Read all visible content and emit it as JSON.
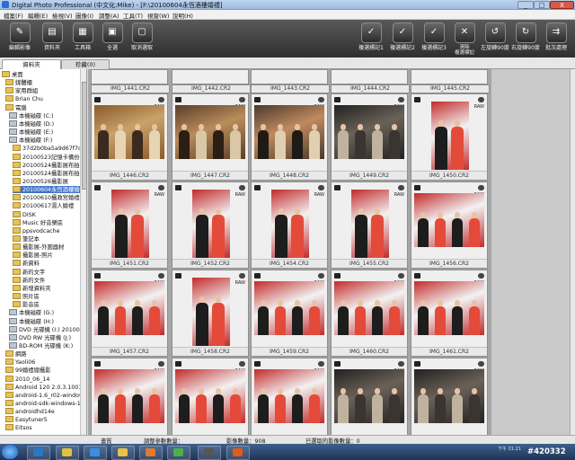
{
  "window": {
    "title": "Digital Photo Professional (中文化:Mike) - [F:\\20100604永恆酒樓婚禮]",
    "min_glyph": "_",
    "max_glyph": "□",
    "close_glyph": "X"
  },
  "menu": [
    "檔案(F)",
    "編輯(E)",
    "檢視(V)",
    "圖像(I)",
    "調整(A)",
    "工具(T)",
    "視窗(W)",
    "說明(H)"
  ],
  "toolbar": {
    "left": [
      {
        "label": "編輯影像",
        "icon": "edit-image-icon",
        "glyph": "✎"
      },
      {
        "label": "資料夾",
        "icon": "folder-icon",
        "glyph": "▤"
      },
      {
        "label": "工具箱",
        "icon": "toolbox-icon",
        "glyph": "▦"
      },
      {
        "label": "全選",
        "icon": "select-all-icon",
        "glyph": "▣"
      },
      {
        "label": "取消選取",
        "icon": "deselect-icon",
        "glyph": "▢"
      }
    ],
    "right": [
      {
        "label": "複選標記1",
        "icon": "check-mark-1-icon",
        "glyph": "✓"
      },
      {
        "label": "複選標記2",
        "icon": "check-mark-2-icon",
        "glyph": "✓"
      },
      {
        "label": "複選標記3",
        "icon": "check-mark-3-icon",
        "glyph": "✓"
      },
      {
        "label": "清除\n複選標記",
        "icon": "clear-check-icon",
        "glyph": "✕"
      },
      {
        "label": "左旋轉90度",
        "icon": "rotate-left-icon",
        "glyph": "↺"
      },
      {
        "label": "右旋轉90度",
        "icon": "rotate-right-icon",
        "glyph": "↻"
      },
      {
        "label": "批次處理",
        "icon": "batch-process-icon",
        "glyph": "⇉"
      }
    ]
  },
  "tabs": [
    "資料夾",
    "珍藏(0)"
  ],
  "tree": [
    {
      "label": "桌面",
      "indent": 0,
      "kind": "folder"
    },
    {
      "label": "媒體櫃",
      "indent": 1,
      "kind": "folder"
    },
    {
      "label": "家用群組",
      "indent": 1,
      "kind": "folder"
    },
    {
      "label": "Brian Chu",
      "indent": 1,
      "kind": "folder"
    },
    {
      "label": "電腦",
      "indent": 1,
      "kind": "folder"
    },
    {
      "label": "本機磁碟 (C:)",
      "indent": 2,
      "kind": "drive"
    },
    {
      "label": "本機磁碟 (D:)",
      "indent": 2,
      "kind": "drive"
    },
    {
      "label": "本機磁碟 (E:)",
      "indent": 2,
      "kind": "drive"
    },
    {
      "label": "本機磁碟 (F:)",
      "indent": 2,
      "kind": "drive"
    },
    {
      "label": "37d2b0ba5a9d67f7c6",
      "indent": 3,
      "kind": "folder"
    },
    {
      "label": "20100523記憶卡備份",
      "indent": 3,
      "kind": "folder"
    },
    {
      "label": "20100524攝影展布拍",
      "indent": 3,
      "kind": "folder"
    },
    {
      "label": "20100524攝影展布拍-F",
      "indent": 3,
      "kind": "folder"
    },
    {
      "label": "20100526攝影展",
      "indent": 3,
      "kind": "folder"
    },
    {
      "label": "20100604永恆酒樓婚禮",
      "indent": 3,
      "kind": "folder",
      "selected": true
    },
    {
      "label": "20100610攝政宮婚禮新",
      "indent": 3,
      "kind": "folder"
    },
    {
      "label": "20100617湯人婚禮",
      "indent": 3,
      "kind": "folder"
    },
    {
      "label": "DISK",
      "indent": 3,
      "kind": "folder"
    },
    {
      "label": "Music 好音樂區",
      "indent": 3,
      "kind": "folder"
    },
    {
      "label": "ppsvodcache",
      "indent": 3,
      "kind": "folder"
    },
    {
      "label": "筆記本",
      "indent": 3,
      "kind": "folder"
    },
    {
      "label": "攝影展-外圍器材",
      "indent": 3,
      "kind": "folder"
    },
    {
      "label": "攝影展-照片",
      "indent": 3,
      "kind": "folder"
    },
    {
      "label": "新資料",
      "indent": 3,
      "kind": "folder"
    },
    {
      "label": "新的文字",
      "indent": 3,
      "kind": "folder"
    },
    {
      "label": "新的文件",
      "indent": 3,
      "kind": "folder"
    },
    {
      "label": "新增資料夾",
      "indent": 3,
      "kind": "folder"
    },
    {
      "label": "照片區",
      "indent": 3,
      "kind": "folder"
    },
    {
      "label": "影音區",
      "indent": 3,
      "kind": "folder"
    },
    {
      "label": "本機磁碟 (G:)",
      "indent": 2,
      "kind": "drive"
    },
    {
      "label": "本機磁碟 (H:)",
      "indent": 2,
      "kind": "drive"
    },
    {
      "label": "DVD 光碟機 (I:) 20100727",
      "indent": 2,
      "kind": "drive"
    },
    {
      "label": "DVD RW 光碟機 (J:)",
      "indent": 2,
      "kind": "drive"
    },
    {
      "label": "BD-ROM 光碟機 (K:)",
      "indent": 2,
      "kind": "drive"
    },
    {
      "label": "網路",
      "indent": 1,
      "kind": "folder"
    },
    {
      "label": "Yaoli06",
      "indent": 1,
      "kind": "folder"
    },
    {
      "label": "99婚禮總攝影",
      "indent": 1,
      "kind": "folder"
    },
    {
      "label": "2010_06_14",
      "indent": 1,
      "kind": "folder"
    },
    {
      "label": "Android 120 2.0.3.1001",
      "indent": 1,
      "kind": "folder"
    },
    {
      "label": "android-1.6_r02-windows",
      "indent": 1,
      "kind": "folder"
    },
    {
      "label": "android-sdk-windows-1.5_r1",
      "indent": 1,
      "kind": "folder"
    },
    {
      "label": "androidhd14e",
      "indent": 1,
      "kind": "folder"
    },
    {
      "label": "Easytuner5",
      "indent": 1,
      "kind": "folder"
    },
    {
      "label": "Eitsos",
      "indent": 1,
      "kind": "folder"
    }
  ],
  "thumbnails": {
    "top_names": [
      "IMG_1441.CR2",
      "IMG_1442.CR2",
      "IMG_1443.CR2",
      "IMG_1444.CR2",
      "IMG_1445.CR2"
    ],
    "rows": [
      [
        "IMG_1446.CR2",
        "IMG_1447.CR2",
        "IMG_1448.CR2",
        "IMG_1449.CR2",
        "IMG_1450.CR2"
      ],
      [
        "IMG_1451.CR2",
        "IMG_1452.CR2",
        "IMG_1454.CR2",
        "IMG_1455.CR2",
        "IMG_1456.CR2"
      ],
      [
        "IMG_1457.CR2",
        "IMG_1458.CR2",
        "IMG_1459.CR2",
        "IMG_1460.CR2",
        "IMG_1461.CR2"
      ],
      [
        "",
        "",
        "",
        "",
        ""
      ]
    ],
    "raw_label": "RAW"
  },
  "status": {
    "page": "畫質",
    "adjust": "調整參數數量：",
    "count_label": "影像數量：908",
    "selected": "已選取的影像數量：0"
  },
  "taskbar": {
    "clock": "下午 01:21",
    "watermark": "#420332",
    "apps": [
      {
        "icon": "photoshop-icon",
        "color": "#2a76c9"
      },
      {
        "icon": "chrome-icon",
        "color": "#e0c23c"
      },
      {
        "icon": "ie-icon",
        "color": "#3a8ee8"
      },
      {
        "icon": "explorer-icon",
        "color": "#e8c14a"
      },
      {
        "icon": "media-player-icon",
        "color": "#e07a2e"
      },
      {
        "icon": "green-app-icon",
        "color": "#4bb04a"
      },
      {
        "icon": "dpp-icon",
        "color": "#555555"
      },
      {
        "icon": "firefox-icon",
        "color": "#e25a1c"
      }
    ]
  }
}
